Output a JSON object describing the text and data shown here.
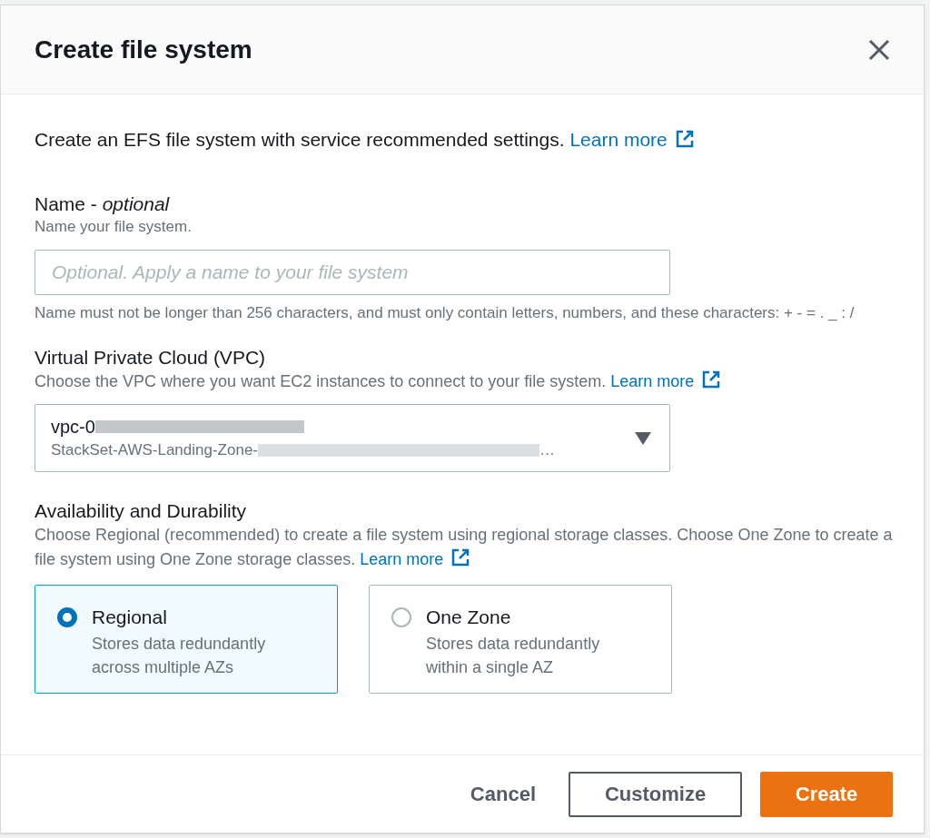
{
  "dialog": {
    "title": "Create file system"
  },
  "intro": {
    "text": "Create an EFS file system with service recommended settings.",
    "link": "Learn more"
  },
  "name_field": {
    "label": "Name - ",
    "label_suffix": "optional",
    "description": "Name your file system.",
    "placeholder": "Optional. Apply a name to your file system",
    "constraint": "Name must not be longer than 256 characters, and must only contain letters, numbers, and these characters: + - = . _ : /"
  },
  "vpc": {
    "label": "Virtual Private Cloud (VPC)",
    "description": "Choose the VPC where you want EC2 instances to connect to your file system.",
    "link": "Learn more",
    "value": "vpc-0",
    "detail": "StackSet-AWS-Landing-Zone-",
    "detail_end": "…"
  },
  "availability": {
    "label": "Availability and Durability",
    "description": "Choose Regional (recommended) to create a file system using regional storage classes. Choose One Zone to create a file system using One Zone storage classes.",
    "link": "Learn more",
    "options": [
      {
        "label": "Regional",
        "description": "Stores data redundantly across multiple AZs",
        "selected": true
      },
      {
        "label": "One Zone",
        "description": "Stores data redundantly within a single AZ",
        "selected": false
      }
    ]
  },
  "footer": {
    "buttons": [
      {
        "label": "Cancel",
        "kind": "link"
      },
      {
        "label": "Customize",
        "kind": "secondary"
      },
      {
        "label": "Create",
        "kind": "primary"
      }
    ]
  }
}
